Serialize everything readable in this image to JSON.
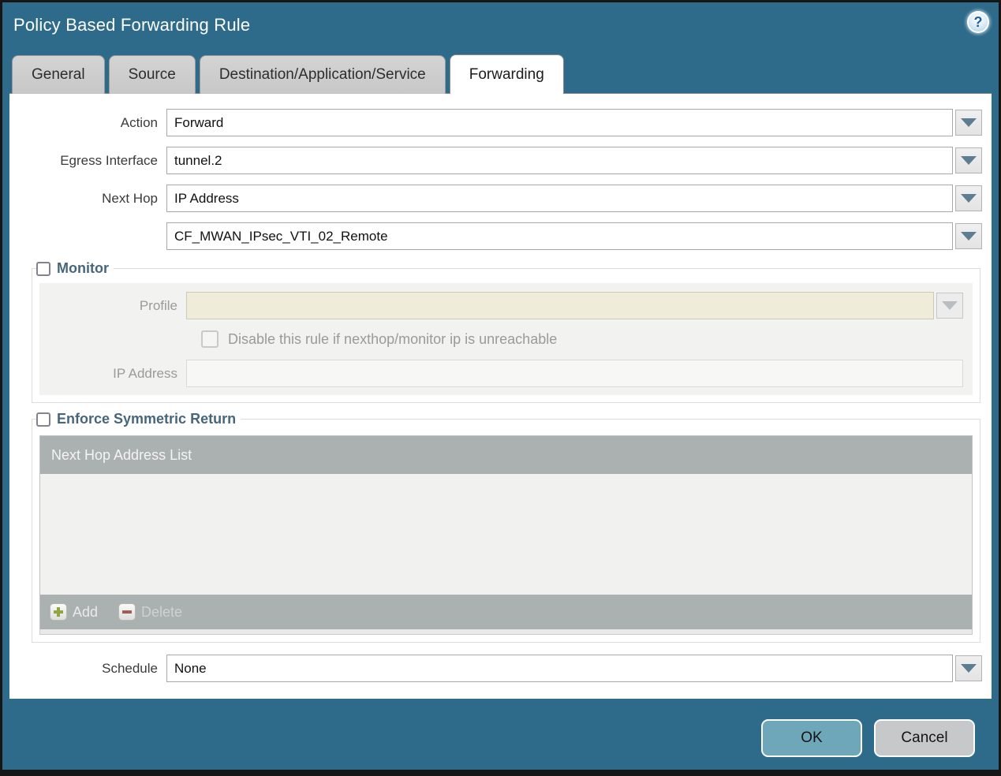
{
  "dialog": {
    "title": "Policy Based Forwarding Rule",
    "help_glyph": "?"
  },
  "tabs": [
    {
      "label": "General",
      "active": false
    },
    {
      "label": "Source",
      "active": false
    },
    {
      "label": "Destination/Application/Service",
      "active": false
    },
    {
      "label": "Forwarding",
      "active": true
    }
  ],
  "form": {
    "action": {
      "label": "Action",
      "value": "Forward"
    },
    "egress_interface": {
      "label": "Egress Interface",
      "value": "tunnel.2"
    },
    "next_hop": {
      "label": "Next Hop",
      "value": "IP Address"
    },
    "next_hop_address": {
      "value": "CF_MWAN_IPsec_VTI_02_Remote"
    },
    "schedule": {
      "label": "Schedule",
      "value": "None"
    }
  },
  "monitor": {
    "legend": "Monitor",
    "checked": false,
    "profile": {
      "label": "Profile",
      "value": ""
    },
    "disable_checkbox_label": "Disable this rule if nexthop/monitor ip is unreachable",
    "ip_address": {
      "label": "IP Address",
      "value": ""
    }
  },
  "symmetric_return": {
    "legend": "Enforce Symmetric Return",
    "checked": false,
    "table_header": "Next Hop Address List",
    "rows": [],
    "add_label": "Add",
    "delete_label": "Delete"
  },
  "footer": {
    "ok_label": "OK",
    "cancel_label": "Cancel"
  },
  "colors": {
    "titlebar_bg": "#2e6b8b",
    "ok_button_bg": "#6ea7b9",
    "cancel_button_bg": "#c6c8ca",
    "table_header_bg": "#abb0b1",
    "disabled_profile_field_bg": "#f0ecda",
    "legend_text": "#46667c",
    "dropdown_arrow": "#5f7d90"
  }
}
